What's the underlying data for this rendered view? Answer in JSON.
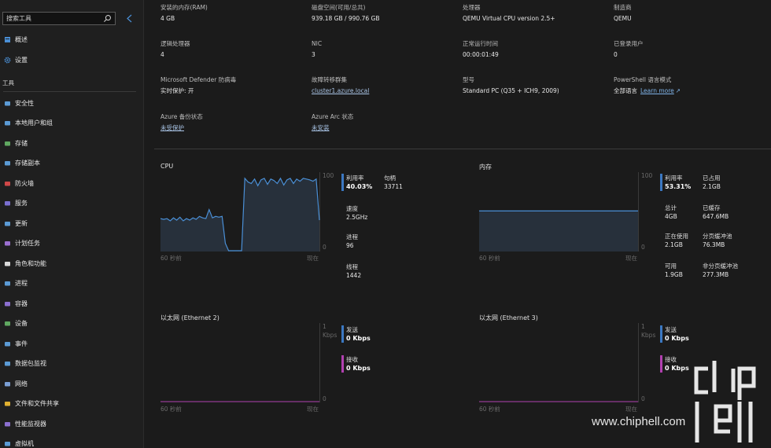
{
  "sidebar": {
    "search_placeholder": "搜索工具",
    "top_items": [
      {
        "label": "概述",
        "icon": "overview-icon"
      },
      {
        "label": "设置",
        "icon": "gear-icon"
      }
    ],
    "section_label": "工具",
    "tools": [
      {
        "label": "安全性",
        "icon": "shield-icon"
      },
      {
        "label": "本地用户和组",
        "icon": "users-icon"
      },
      {
        "label": "存储",
        "icon": "storage-icon"
      },
      {
        "label": "存储副本",
        "icon": "storage-replica-icon"
      },
      {
        "label": "防火墙",
        "icon": "firewall-icon"
      },
      {
        "label": "服务",
        "icon": "services-icon"
      },
      {
        "label": "更新",
        "icon": "updates-icon"
      },
      {
        "label": "计划任务",
        "icon": "scheduled-tasks-icon"
      },
      {
        "label": "角色和功能",
        "icon": "roles-icon"
      },
      {
        "label": "进程",
        "icon": "processes-icon"
      },
      {
        "label": "容器",
        "icon": "containers-icon"
      },
      {
        "label": "设备",
        "icon": "devices-icon"
      },
      {
        "label": "事件",
        "icon": "events-icon"
      },
      {
        "label": "数据包监视",
        "icon": "packet-monitor-icon"
      },
      {
        "label": "网络",
        "icon": "network-icon"
      },
      {
        "label": "文件和文件共享",
        "icon": "folder-icon"
      },
      {
        "label": "性能监视器",
        "icon": "performance-icon"
      },
      {
        "label": "虚拟机",
        "icon": "virtual-machine-icon"
      }
    ]
  },
  "info": {
    "rows": [
      [
        {
          "key": "安装的内存(RAM)",
          "value": "4 GB"
        },
        {
          "key": "磁盘空间(可用/总共)",
          "value": "939.18 GB / 990.76 GB"
        },
        {
          "key": "处理器",
          "value": "QEMU Virtual CPU version 2.5+"
        },
        {
          "key": "制造商",
          "value": "QEMU"
        }
      ],
      [
        {
          "key": "逻辑处理器",
          "value": "4"
        },
        {
          "key": "NIC",
          "value": "3"
        },
        {
          "key": "正常运行时间",
          "value": "00:00:01:49"
        },
        {
          "key": "已登录用户",
          "value": "0"
        }
      ],
      [
        {
          "key": "Microsoft Defender 防病毒",
          "value": "实时保护: 开"
        },
        {
          "key": "故障转移群集",
          "value": "cluster1.azure.local",
          "link": true
        },
        {
          "key": "型号",
          "value": "Standard PC (Q35 + ICH9, 2009)"
        },
        {
          "key": "PowerShell 语言模式",
          "value": "全部语言",
          "extra_link": "Learn more"
        }
      ],
      [
        {
          "key": "Azure 备份状态",
          "value": "未受保护",
          "link": true
        },
        {
          "key": "Azure Arc 状态",
          "value": "未安装",
          "link": true
        }
      ]
    ]
  },
  "cpu": {
    "title": "CPU",
    "y_max": "100",
    "y_min": "0",
    "x_left": "60 秒前",
    "x_right": "现在",
    "stats": [
      {
        "label": "利用率",
        "value": "40.03%"
      },
      {
        "label": "句柄",
        "value": "33711"
      },
      {
        "label": "速度",
        "value": "2.5GHz"
      },
      {
        "label": "进程",
        "value": "96"
      },
      {
        "label": "线程",
        "value": "1442"
      }
    ],
    "chart_data": {
      "type": "area",
      "ylim": [
        0,
        100
      ],
      "values": [
        43,
        42,
        43,
        40,
        44,
        41,
        45,
        40,
        43,
        41,
        44,
        42,
        46,
        44,
        43,
        55,
        44,
        46,
        45,
        46,
        10,
        0,
        0,
        0,
        0,
        0,
        97,
        92,
        90,
        96,
        87,
        95,
        97,
        89,
        96,
        94,
        90,
        97,
        88,
        95,
        97,
        90,
        96,
        93,
        97,
        96,
        95,
        93,
        96,
        41
      ]
    }
  },
  "memory": {
    "title": "内存",
    "y_max": "100",
    "y_min": "0",
    "x_left": "60 秒前",
    "x_right": "现在",
    "stats": [
      {
        "label": "利用率",
        "value": "53.31%"
      },
      {
        "label": "已占用",
        "value": "2.1GB"
      },
      {
        "label": "总计",
        "value": "4GB"
      },
      {
        "label": "已缓存",
        "value": "647.6MB"
      },
      {
        "label": "正在使用",
        "value": "2.1GB"
      },
      {
        "label": "分页缓冲池",
        "value": "76.3MB"
      },
      {
        "label": "可用",
        "value": "1.9GB"
      },
      {
        "label": "非分页缓冲池",
        "value": "277.3MB"
      }
    ],
    "chart_data": {
      "type": "area",
      "ylim": [
        0,
        100
      ],
      "values": [
        53.3,
        53.3,
        53.3,
        53.3,
        53.3,
        53.3,
        53.3,
        53.3,
        53.3,
        53.3,
        53.3,
        53.3,
        53.3,
        53.3,
        53.3,
        53.3,
        53.3,
        53.3,
        53.3,
        53.3,
        53.3,
        53.3,
        53.3,
        53.3,
        53.3,
        53.3,
        53.3,
        53.3,
        53.3,
        53.3,
        53.3,
        53.3,
        53.3,
        53.3,
        53.3,
        53.3,
        53.3,
        53.3,
        53.3,
        53.3,
        53.3,
        53.3,
        53.3,
        53.3,
        53.3,
        53.3,
        53.3,
        53.3,
        53.3,
        53.31
      ]
    }
  },
  "eth2": {
    "title": "以太网 (Ethernet 2)",
    "y_max": "1",
    "y_unit": "Kbps",
    "y_min": "0",
    "x_left": "60 秒前",
    "x_right": "现在",
    "stats": [
      {
        "label": "发送",
        "value": "0 Kbps"
      },
      {
        "label": "接收",
        "value": "0 Kbps"
      }
    ],
    "chart_data": {
      "type": "line",
      "ylim": [
        0,
        1
      ],
      "series": [
        {
          "name": "发送",
          "values": [
            0,
            0,
            0,
            0,
            0,
            0,
            0,
            0,
            0,
            0
          ]
        },
        {
          "name": "接收",
          "values": [
            0,
            0,
            0,
            0,
            0,
            0,
            0,
            0,
            0,
            0
          ]
        }
      ]
    }
  },
  "eth3": {
    "title": "以太网 (Ethernet 3)",
    "y_max": "1",
    "y_unit": "Kbps",
    "y_min": "0",
    "x_left": "60 秒前",
    "x_right": "现在",
    "stats": [
      {
        "label": "发送",
        "value": "0 Kbps"
      },
      {
        "label": "接收",
        "value": "0 Kbps"
      }
    ],
    "chart_data": {
      "type": "line",
      "ylim": [
        0,
        1
      ],
      "series": [
        {
          "name": "发送",
          "values": [
            0,
            0,
            0,
            0,
            0,
            0,
            0,
            0,
            0,
            0
          ]
        },
        {
          "name": "接收",
          "values": [
            0,
            0,
            0,
            0,
            0,
            0,
            0,
            0,
            0,
            0
          ]
        }
      ]
    }
  },
  "watermark": {
    "text": "www.chiphell.com",
    "logo_text": "chiphell"
  },
  "colors": {
    "accent": "#3b78c2",
    "line": "#4a8fd6",
    "fill": "#27303b",
    "receive": "#b140b0"
  }
}
